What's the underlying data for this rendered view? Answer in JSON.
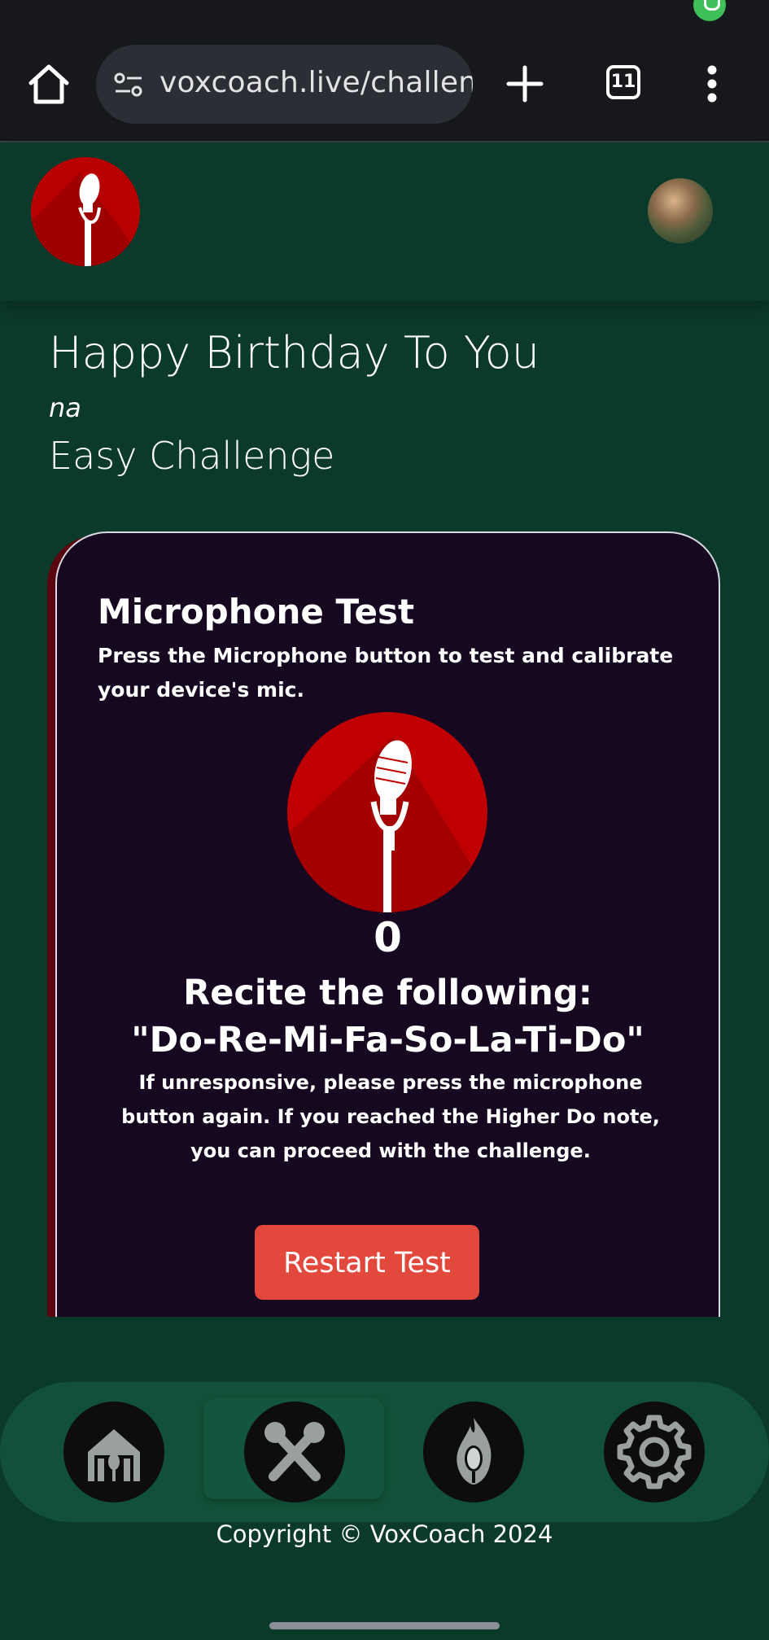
{
  "browser": {
    "url": "voxcoach.live/challenge",
    "tab_count": "11"
  },
  "song": {
    "title": "Happy Birthday To You",
    "artist": "na",
    "difficulty": "Easy Challenge"
  },
  "mic_test": {
    "title": "Microphone Test",
    "description": "Press the Microphone button to test and calibrate your device's mic.",
    "counter": "0",
    "recite_label": "Recite the following:",
    "notes": "\"Do-Re-Mi-Fa-So-La-Ti-Do\"",
    "instructions": "If unresponsive, please press the microphone button again. If you reached the Higher Do note, you can proceed with the challenge.",
    "restart_label": "Restart Test"
  },
  "nav": {
    "items": [
      "home-icon",
      "crossed-microphones-icon",
      "flame-microphone-icon",
      "gear-icon"
    ],
    "active_index": 1
  },
  "footer": {
    "copyright": "Copyright © VoxCoach 2024"
  },
  "colors": {
    "page_bg": "#0b3a2b",
    "card_bg": "#160821",
    "nav_bg": "#125139",
    "accent_red": "#e2483c",
    "mic_red": "#c00000"
  }
}
